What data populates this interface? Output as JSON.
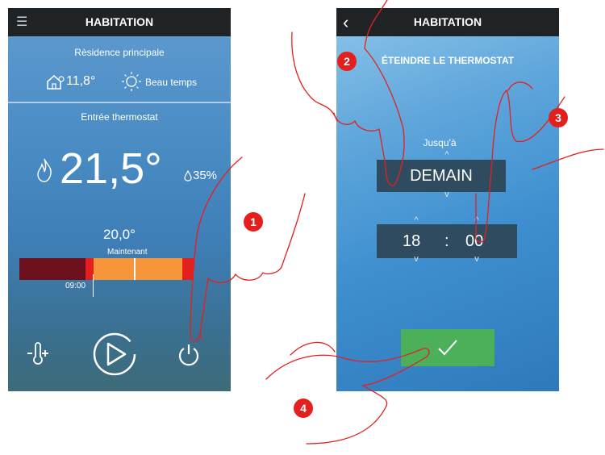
{
  "left_screen": {
    "title": "HABITATION",
    "home_name": "Rèsidence principale",
    "outdoor_temp": "11,8°",
    "weather": "Beau temps",
    "thermostat_name": "Entrée thermostat",
    "current_temp": "21,5°",
    "humidity": "35%",
    "setpoint": "20,0°",
    "mode_label": "Maintenant",
    "time_marker": "09:00",
    "icons": [
      "menu-icon",
      "house-sensor-icon",
      "sun-icon",
      "flame-icon",
      "drop-icon",
      "thermometer-plus-icon",
      "play-icon",
      "power-icon"
    ]
  },
  "right_screen": {
    "title": "HABITATION",
    "heading": "ÉTEINDRE LE THERMOSTAT",
    "until_label": "Jusqu'à",
    "day_value": "DEMAIN",
    "hour_value": "18",
    "separator": ":",
    "minute_value": "00",
    "confirm_icon": "check-icon",
    "back_icon": "back-chevron-icon"
  },
  "callouts": [
    "1",
    "2",
    "3",
    "4"
  ],
  "colors": {
    "topbar": "#1f2326",
    "dark_red": "#6e0f1e",
    "bright_red": "#e4201f",
    "orange": "#f7953b",
    "confirm_green": "#4caf5a",
    "selector_bg": "#2f4b60"
  }
}
